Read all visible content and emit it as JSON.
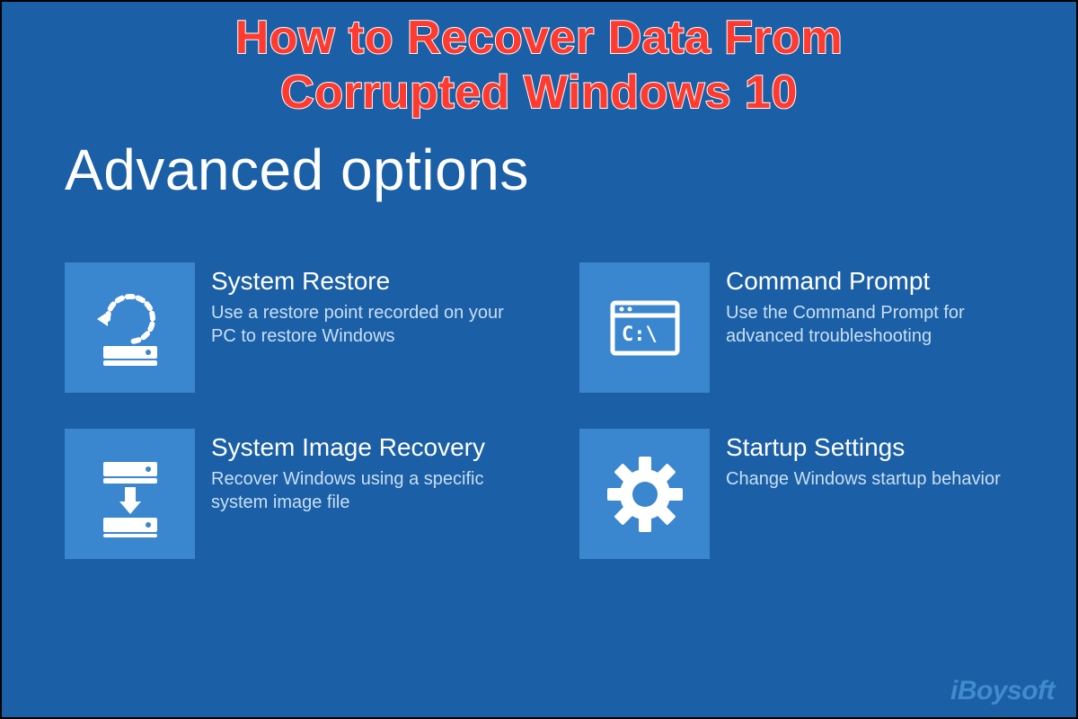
{
  "overlay": {
    "title_line1": "How to Recover Data From",
    "title_line2": "Corrupted Windows 10"
  },
  "page": {
    "heading": "Advanced options"
  },
  "options": [
    {
      "icon": "system-restore-icon",
      "title": "System Restore",
      "description": "Use a restore point recorded on your PC to restore Windows"
    },
    {
      "icon": "command-prompt-icon",
      "title": "Command Prompt",
      "description": "Use the Command Prompt for advanced troubleshooting"
    },
    {
      "icon": "system-image-recovery-icon",
      "title": "System Image Recovery",
      "description": "Recover Windows using a specific system image file"
    },
    {
      "icon": "startup-settings-icon",
      "title": "Startup Settings",
      "description": "Change Windows startup behavior"
    }
  ],
  "watermark": "iBoysoft",
  "colors": {
    "background": "#1b5fa6",
    "tile": "#3a86cf",
    "accent_text": "#ff3b2f",
    "desc_text": "#c9dff3"
  }
}
